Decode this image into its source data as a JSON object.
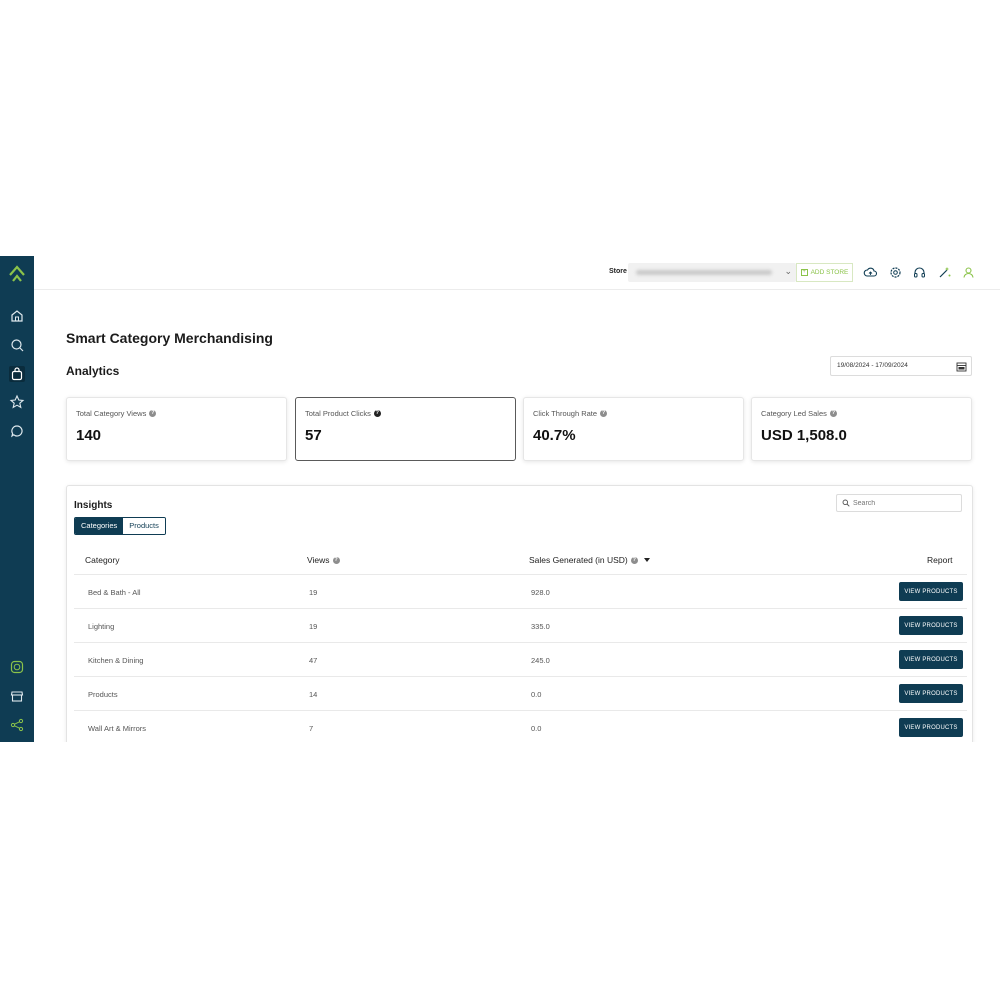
{
  "colors": {
    "primary": "#0f3c53",
    "accent": "#8bc34a",
    "sidebar_icon": "#dfe9ee"
  },
  "topbar": {
    "store_label": "Store",
    "add_store_label": "ADD STORE",
    "icons": [
      "cloud-icon",
      "settings-icon",
      "headset-icon",
      "wand-icon",
      "user-icon"
    ]
  },
  "sidebar": {
    "icons": [
      "logo-icon",
      "home-icon",
      "search-refresh-icon",
      "shopping-bag-icon",
      "star-icon",
      "chat-icon",
      "whatsapp-icon",
      "storefront-icon",
      "share-network-icon"
    ]
  },
  "page": {
    "title": "Smart Category Merchandising",
    "section": "Analytics",
    "date_range": "19/08/2024 - 17/09/2024"
  },
  "stats": [
    {
      "label": "Total Category Views",
      "value": "140"
    },
    {
      "label": "Total Product Clicks",
      "value": "57"
    },
    {
      "label": "Click Through Rate",
      "value": "40.7%"
    },
    {
      "label": "Category Led Sales",
      "value": "USD 1,508.0"
    }
  ],
  "insights": {
    "title": "Insights",
    "tabs": [
      {
        "label": "Categories",
        "selected": true
      },
      {
        "label": "Products",
        "selected": false
      }
    ],
    "search_placeholder": "Search",
    "columns": {
      "category": "Category",
      "views": "Views",
      "sales": "Sales Generated (in USD)",
      "report": "Report"
    },
    "rows": [
      {
        "category": "Bed & Bath - All",
        "views": "19",
        "sales": "928.0",
        "action": "VIEW PRODUCTS"
      },
      {
        "category": "Lighting",
        "views": "19",
        "sales": "335.0",
        "action": "VIEW PRODUCTS"
      },
      {
        "category": "Kitchen & Dining",
        "views": "47",
        "sales": "245.0",
        "action": "VIEW PRODUCTS"
      },
      {
        "category": "Products",
        "views": "14",
        "sales": "0.0",
        "action": "VIEW PRODUCTS"
      },
      {
        "category": "Wall Art & Mirrors",
        "views": "7",
        "sales": "0.0",
        "action": "VIEW PRODUCTS"
      }
    ]
  }
}
